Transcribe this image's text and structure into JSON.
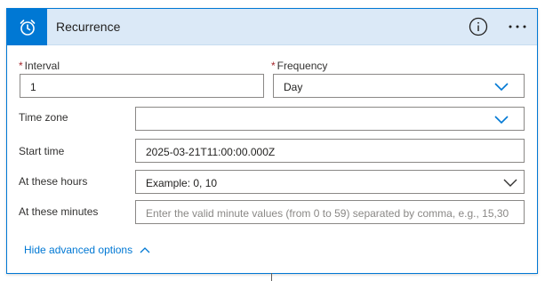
{
  "header": {
    "title": "Recurrence",
    "info_icon": "info-icon",
    "more_icon": "more-options-icon",
    "trigger_icon": "alarm-clock-icon",
    "accent": "#0078d4",
    "background": "#dbe9f7"
  },
  "fields": {
    "interval": {
      "label": "Interval",
      "required": "*",
      "value": "1"
    },
    "frequency": {
      "label": "Frequency",
      "required": "*",
      "value": "Day"
    },
    "time_zone": {
      "label": "Time zone",
      "value": ""
    },
    "start_time": {
      "label": "Start time",
      "value": "2025-03-21T11:00:00.000Z"
    },
    "at_hours": {
      "label": "At these hours",
      "placeholder": "Example: 0, 10"
    },
    "at_minutes": {
      "label": "At these minutes",
      "placeholder": "Enter the valid minute values (from 0 to 59) separated by comma, e.g., 15,30"
    }
  },
  "advanced_toggle": {
    "label": "Hide advanced options"
  }
}
